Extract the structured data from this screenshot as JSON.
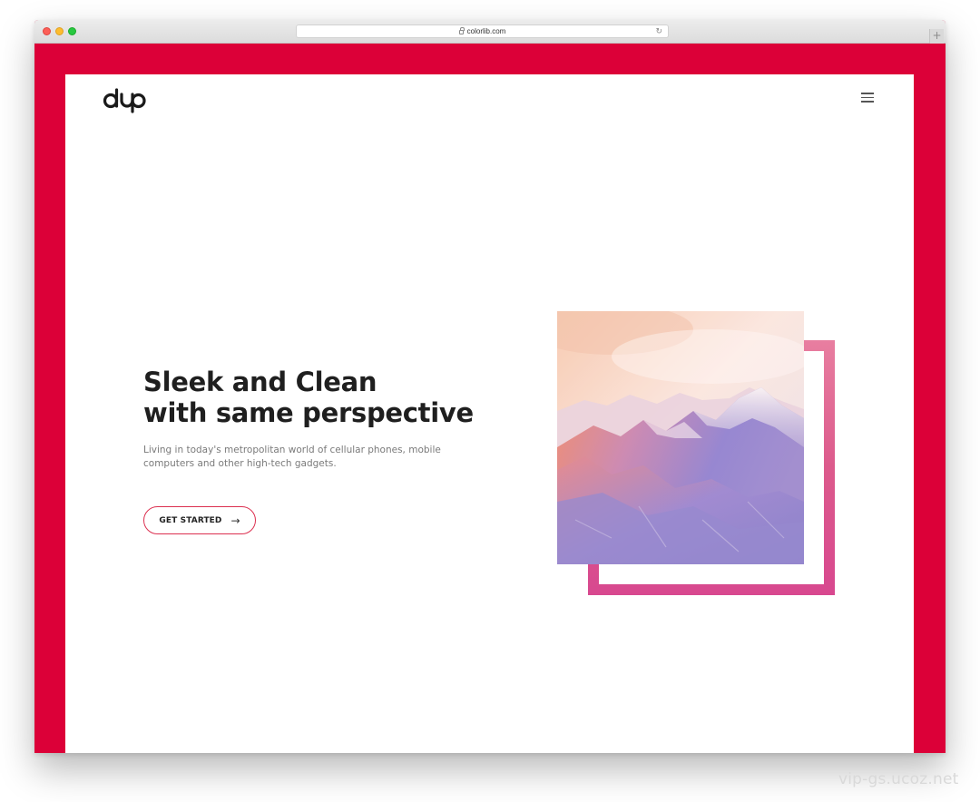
{
  "browser": {
    "url": "colorlib.com",
    "reload_glyph": "↻",
    "newtab_glyph": "+"
  },
  "header": {
    "logo_alt": "dup logo",
    "menu_icon": "hamburger-menu-icon"
  },
  "hero": {
    "title_line1": "Sleek and Clean",
    "title_line2": "with same perspective",
    "subtitle": "Living in today's metropolitan world of cellular phones, mobile computers and other high-tech gadgets.",
    "cta_label": "GET STARTED",
    "cta_arrow": "→"
  },
  "image": {
    "subject": "mountain landscape photo with pink-purple gradient overlay"
  },
  "watermark": "vip-gs.ucoz.net",
  "colors": {
    "accent": "#dc0038",
    "button_border": "#dc3050",
    "frame_pink": "#de5a8c"
  }
}
